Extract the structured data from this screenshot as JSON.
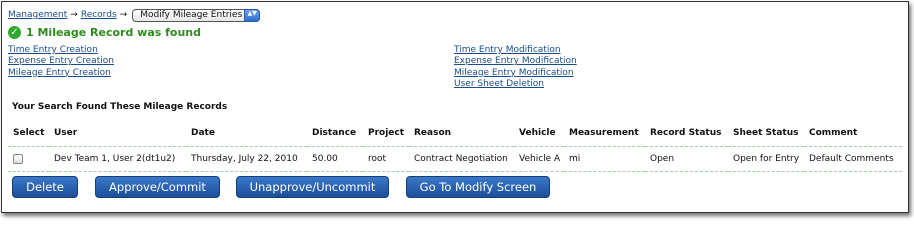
{
  "breadcrumb": {
    "management": "Management",
    "arrow": "→",
    "records": "Records",
    "select_value": "Modify Mileage Entries",
    "select_arrows": "▲▼"
  },
  "status": {
    "message": "1 Mileage Record was found",
    "icon_glyph": "✓"
  },
  "links": {
    "left": [
      "Time Entry Creation",
      "Expense Entry Creation",
      "Mileage Entry Creation"
    ],
    "right": [
      "Time Entry Modification",
      "Expense Entry Modification",
      "Mileage Entry Modification",
      "User Sheet Deletion"
    ]
  },
  "table": {
    "title": "Your Search Found These Mileage Records",
    "headers": [
      "Select",
      "User",
      "Date",
      "Distance",
      "Project",
      "Reason",
      "Vehicle",
      "Measurement",
      "Record Status",
      "Sheet Status",
      "Comment"
    ],
    "rows": [
      [
        "",
        "Dev Team 1, User 2(dt1u2)",
        "Thursday, July 22, 2010",
        "50.00",
        "root",
        "Contract Negotiation",
        "Vehicle A",
        "mi",
        "Open",
        "Open for Entry",
        "Default Comments"
      ]
    ]
  },
  "buttons": {
    "delete": "Delete",
    "approve": "Approve/Commit",
    "unapprove": "Unapprove/Uncommit",
    "modify": "Go To Modify Screen"
  },
  "colors": {
    "link": "#1a4c8c",
    "success": "#2e8b1e",
    "button": "#2a62b0"
  }
}
